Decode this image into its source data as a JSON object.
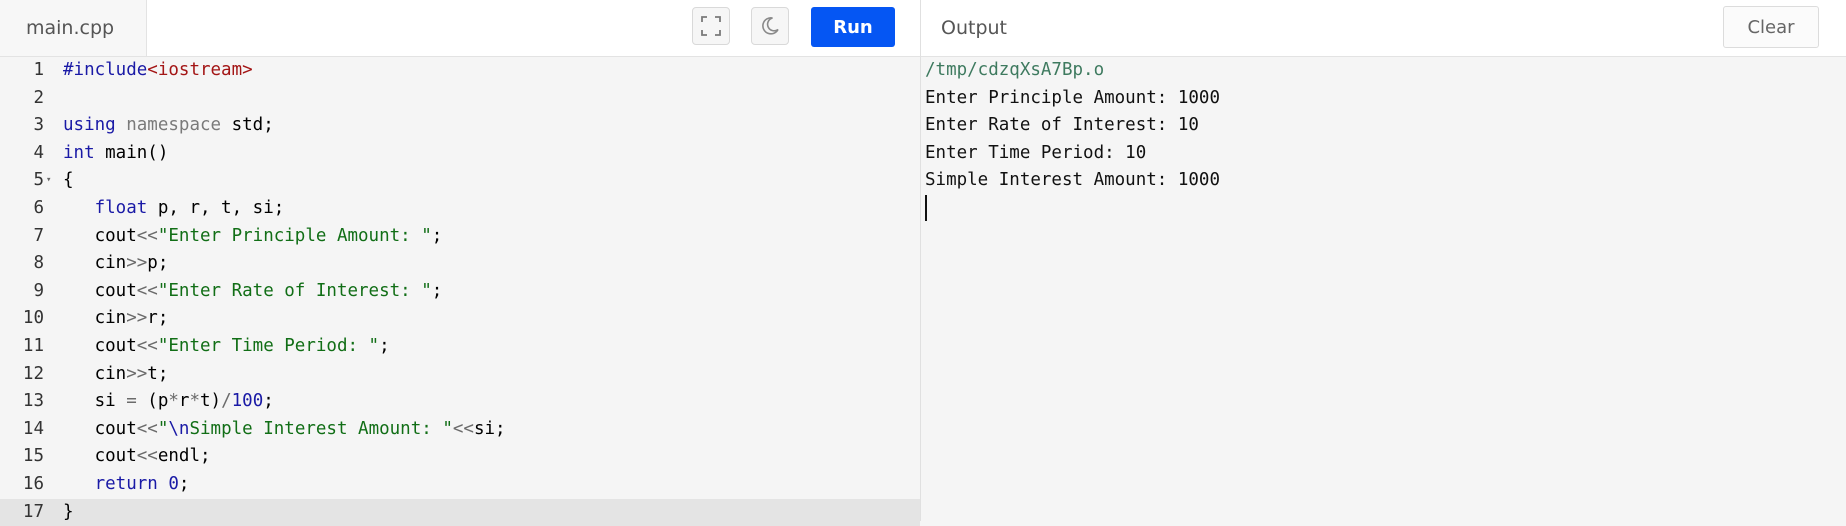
{
  "editor": {
    "file_tab": "main.cpp",
    "run_label": "Run",
    "fullscreen_icon": "fullscreen-icon",
    "theme_icon": "moon-icon",
    "lines": [
      {
        "n": "1",
        "tokens": [
          {
            "t": "#include",
            "c": "pre"
          },
          {
            "t": "<iostream>",
            "c": "incl"
          }
        ]
      },
      {
        "n": "2",
        "tokens": []
      },
      {
        "n": "3",
        "tokens": [
          {
            "t": "using",
            "c": "kw"
          },
          {
            "t": " namespace",
            "c": "grey"
          },
          {
            "t": " std;",
            "c": "plain"
          }
        ]
      },
      {
        "n": "4",
        "tokens": [
          {
            "t": "int",
            "c": "kw"
          },
          {
            "t": " main()",
            "c": "plain"
          }
        ]
      },
      {
        "n": "5",
        "tokens": [
          {
            "t": "{",
            "c": "plain"
          }
        ],
        "fold": true
      },
      {
        "n": "6",
        "tokens": [
          {
            "t": "   ",
            "c": "plain"
          },
          {
            "t": "float",
            "c": "kw"
          },
          {
            "t": " p, r, t, si;",
            "c": "plain"
          }
        ]
      },
      {
        "n": "7",
        "tokens": [
          {
            "t": "   cout",
            "c": "plain"
          },
          {
            "t": "<<",
            "c": "op"
          },
          {
            "t": "\"Enter Principle Amount: \"",
            "c": "str"
          },
          {
            "t": ";",
            "c": "plain"
          }
        ]
      },
      {
        "n": "8",
        "tokens": [
          {
            "t": "   cin",
            "c": "plain"
          },
          {
            "t": ">>",
            "c": "op"
          },
          {
            "t": "p;",
            "c": "plain"
          }
        ]
      },
      {
        "n": "9",
        "tokens": [
          {
            "t": "   cout",
            "c": "plain"
          },
          {
            "t": "<<",
            "c": "op"
          },
          {
            "t": "\"Enter Rate of Interest: \"",
            "c": "str"
          },
          {
            "t": ";",
            "c": "plain"
          }
        ]
      },
      {
        "n": "10",
        "tokens": [
          {
            "t": "   cin",
            "c": "plain"
          },
          {
            "t": ">>",
            "c": "op"
          },
          {
            "t": "r;",
            "c": "plain"
          }
        ]
      },
      {
        "n": "11",
        "tokens": [
          {
            "t": "   cout",
            "c": "plain"
          },
          {
            "t": "<<",
            "c": "op"
          },
          {
            "t": "\"Enter Time Period: \"",
            "c": "str"
          },
          {
            "t": ";",
            "c": "plain"
          }
        ]
      },
      {
        "n": "12",
        "tokens": [
          {
            "t": "   cin",
            "c": "plain"
          },
          {
            "t": ">>",
            "c": "op"
          },
          {
            "t": "t;",
            "c": "plain"
          }
        ]
      },
      {
        "n": "13",
        "tokens": [
          {
            "t": "   si ",
            "c": "plain"
          },
          {
            "t": "=",
            "c": "op"
          },
          {
            "t": " (p",
            "c": "plain"
          },
          {
            "t": "*",
            "c": "op"
          },
          {
            "t": "r",
            "c": "plain"
          },
          {
            "t": "*",
            "c": "op"
          },
          {
            "t": "t)",
            "c": "plain"
          },
          {
            "t": "/",
            "c": "op"
          },
          {
            "t": "100",
            "c": "num"
          },
          {
            "t": ";",
            "c": "plain"
          }
        ]
      },
      {
        "n": "14",
        "tokens": [
          {
            "t": "   cout",
            "c": "plain"
          },
          {
            "t": "<<",
            "c": "op"
          },
          {
            "t": "\"",
            "c": "str"
          },
          {
            "t": "\\n",
            "c": "kw"
          },
          {
            "t": "Simple Interest Amount: \"",
            "c": "str"
          },
          {
            "t": "<<",
            "c": "op"
          },
          {
            "t": "si;",
            "c": "plain"
          }
        ]
      },
      {
        "n": "15",
        "tokens": [
          {
            "t": "   cout",
            "c": "plain"
          },
          {
            "t": "<<",
            "c": "op"
          },
          {
            "t": "endl;",
            "c": "plain"
          }
        ]
      },
      {
        "n": "16",
        "tokens": [
          {
            "t": "   ",
            "c": "plain"
          },
          {
            "t": "return",
            "c": "kw"
          },
          {
            "t": " ",
            "c": "plain"
          },
          {
            "t": "0",
            "c": "num"
          },
          {
            "t": ";",
            "c": "plain"
          }
        ]
      },
      {
        "n": "17",
        "tokens": [
          {
            "t": "}",
            "c": "plain"
          }
        ],
        "active": true
      }
    ]
  },
  "output": {
    "title": "Output",
    "clear_label": "Clear",
    "path": "/tmp/cdzqXsA7Bp.o",
    "lines": [
      "Enter Principle Amount: 1000",
      "Enter Rate of Interest: 10",
      "Enter Time Period: 10",
      "Simple Interest Amount: 1000"
    ]
  }
}
